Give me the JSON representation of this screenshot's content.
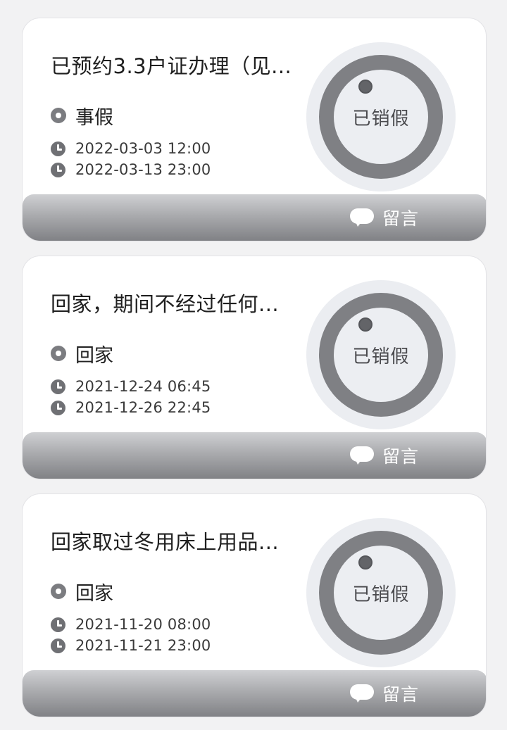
{
  "records": [
    {
      "title": "已预约3.3户证办理（见...",
      "type": "事假",
      "start_time": "2022-03-03 12:00",
      "end_time": "2022-03-13 23:00",
      "status": "已销假",
      "comment_label": "留言"
    },
    {
      "title": "回家，期间不经过任何...",
      "type": "回家",
      "start_time": "2021-12-24 06:45",
      "end_time": "2021-12-26 22:45",
      "status": "已销假",
      "comment_label": "留言"
    },
    {
      "title": "回家取过冬用床上用品...",
      "type": "回家",
      "start_time": "2021-11-20 08:00",
      "end_time": "2021-11-21 23:00",
      "status": "已销假",
      "comment_label": "留言"
    }
  ],
  "icons": {
    "type": "radio-dot-icon",
    "time": "clock-icon",
    "comment": "speech-bubble-icon"
  },
  "colors": {
    "status_ring": "#7f8084",
    "footer_bar": "#a9aaad",
    "background": "#f2f2f3"
  }
}
